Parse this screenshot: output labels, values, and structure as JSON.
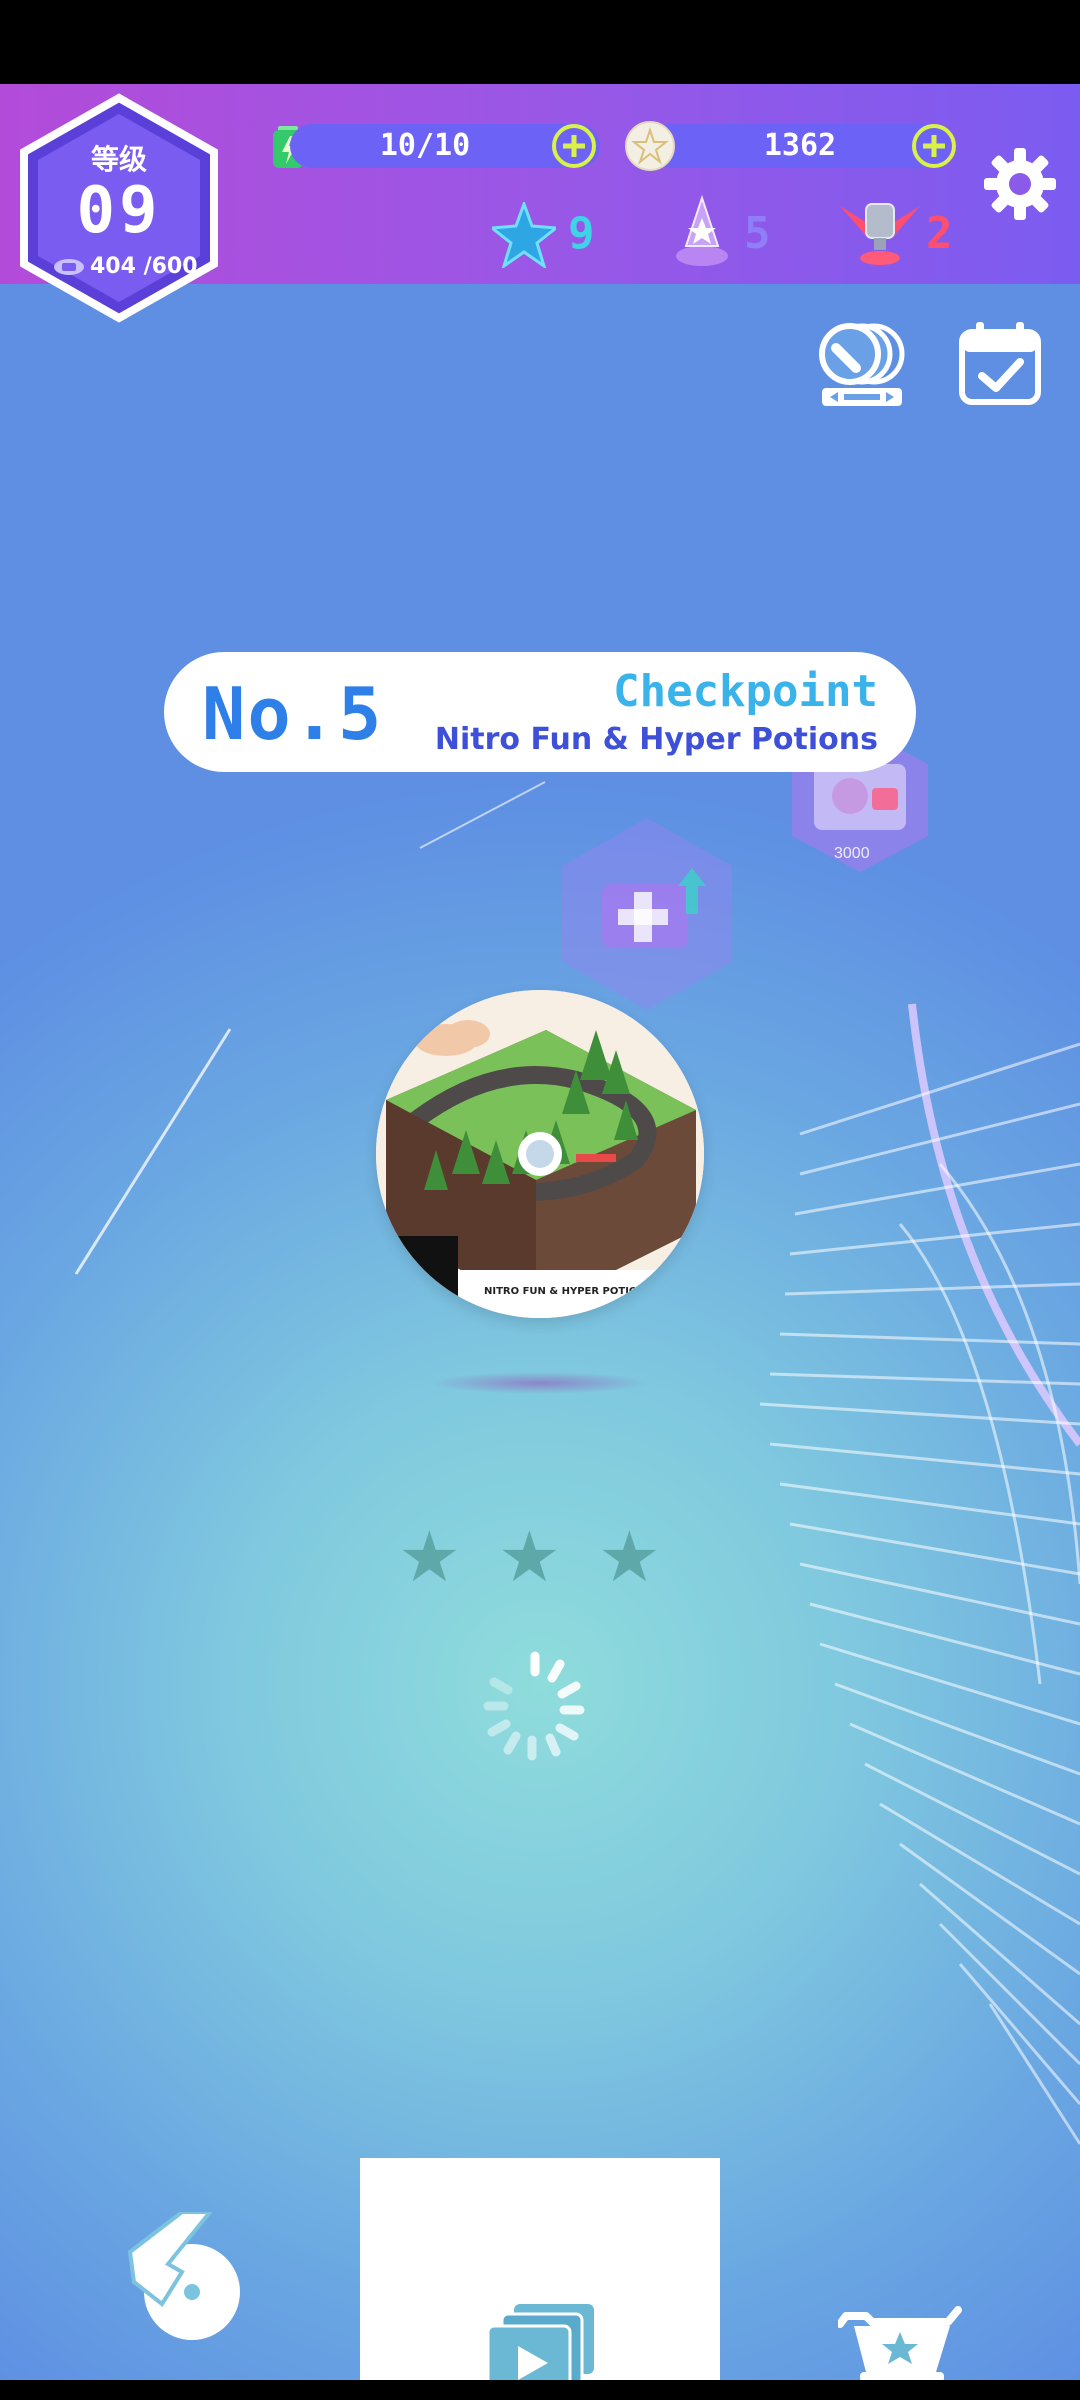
{
  "hud": {
    "level_label": "等级",
    "level_number": "09",
    "level_xp": "404 /600",
    "energy": "10/10",
    "coins": "1362",
    "stars_count": "9",
    "crowns_count": "5",
    "trophies_count": "2"
  },
  "track": {
    "number": "No.5",
    "status": "Checkpoint",
    "title": "Nitro Fun & Hyper Potions",
    "disc_caption": "NITRO FUN & HYPER POTIONS",
    "locked_price": "3000"
  },
  "rating": {
    "stars": [
      "★",
      "★",
      "★"
    ],
    "earned": 0
  },
  "icons": {
    "settings": "gear-icon",
    "gallery": "vinyl-icon",
    "calendar": "calendar-check-icon",
    "left_nav": "hand-disc-icon",
    "center_nav": "play-cards-icon",
    "right_nav": "shopping-cart-star-icon"
  },
  "colors": {
    "hud_start": "#b34bd9",
    "hud_end": "#7b5cf0",
    "accent_lime": "#d9f24a",
    "star_cyan": "#3fd3e6",
    "crown_violet": "#8f7ef7",
    "trophy_red": "#ff4f6e",
    "title_blue": "#2f7fe8"
  }
}
